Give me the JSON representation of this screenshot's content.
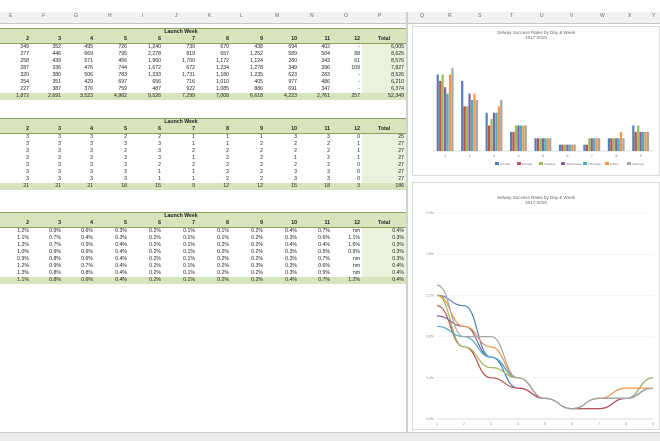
{
  "column_headers": [
    "E",
    "F",
    "G",
    "H",
    "I",
    "J",
    "K",
    "L",
    "M",
    "N",
    "O",
    "P",
    "Q",
    "R",
    "S",
    "T",
    "U",
    "V",
    "W",
    "X",
    "Y"
  ],
  "table1": {
    "title": "Launch Week",
    "headers": [
      "2",
      "3",
      "4",
      "5",
      "6",
      "7",
      "8",
      "9",
      "10",
      "11",
      "12",
      "Total"
    ],
    "rows": [
      [
        "249",
        "352",
        "495",
        "726",
        "1,240",
        "739",
        "670",
        "438",
        "694",
        "402",
        "-",
        "6,005"
      ],
      [
        "277",
        "446",
        "669",
        "795",
        "2,278",
        "819",
        "657",
        "1,252",
        "589",
        "504",
        "88",
        "8,625"
      ],
      [
        "258",
        "439",
        "571",
        "456",
        "1,960",
        "1,700",
        "1,172",
        "1,124",
        "280",
        "343",
        "61",
        "8,576"
      ],
      [
        "287",
        "336",
        "476",
        "744",
        "1,672",
        "672",
        "1,234",
        "1,278",
        "349",
        "396",
        "109",
        "7,827"
      ],
      [
        "320",
        "380",
        "506",
        "783",
        "1,233",
        "1,731",
        "1,180",
        "1,235",
        "623",
        "283",
        "-",
        "8,526"
      ],
      [
        "254",
        "351",
        "429",
        "697",
        "656",
        "716",
        "1,010",
        "405",
        "977",
        "486",
        "-",
        "6,210"
      ],
      [
        "227",
        "387",
        "376",
        "759",
        "487",
        "922",
        "1,085",
        "886",
        "691",
        "347",
        "-",
        "6,374"
      ]
    ],
    "total": [
      "1,872",
      "2,691",
      "3,523",
      "4,962",
      "9,526",
      "7,299",
      "7,008",
      "6,618",
      "4,223",
      "2,761",
      "257",
      "52,349"
    ]
  },
  "table2": {
    "title": "Launch Week",
    "headers": [
      "2",
      "3",
      "4",
      "5",
      "6",
      "7",
      "8",
      "9",
      "10",
      "11",
      "12",
      "Total"
    ],
    "rows": [
      [
        "3",
        "3",
        "3",
        "2",
        "2",
        "1",
        "1",
        "1",
        "3",
        "3",
        "0",
        "25"
      ],
      [
        "3",
        "3",
        "3",
        "3",
        "3",
        "1",
        "1",
        "2",
        "2",
        "2",
        "1",
        "27"
      ],
      [
        "3",
        "3",
        "3",
        "2",
        "3",
        "2",
        "2",
        "2",
        "2",
        "2",
        "1",
        "27"
      ],
      [
        "3",
        "3",
        "3",
        "3",
        "3",
        "1",
        "2",
        "2",
        "1",
        "2",
        "1",
        "27"
      ],
      [
        "3",
        "3",
        "3",
        "3",
        "2",
        "2",
        "2",
        "2",
        "2",
        "2",
        "0",
        "27"
      ],
      [
        "3",
        "3",
        "3",
        "3",
        "1",
        "1",
        "2",
        "2",
        "3",
        "3",
        "0",
        "27"
      ],
      [
        "3",
        "3",
        "3",
        "3",
        "1",
        "1",
        "2",
        "2",
        "3",
        "3",
        "0",
        "27"
      ]
    ],
    "total": [
      "21",
      "21",
      "21",
      "18",
      "15",
      "9",
      "12",
      "12",
      "15",
      "18",
      "3",
      "186"
    ]
  },
  "table3": {
    "title": "Launch Week",
    "headers": [
      "2",
      "3",
      "4",
      "5",
      "6",
      "7",
      "8",
      "9",
      "10",
      "11",
      "12",
      "Total"
    ],
    "rows": [
      [
        "1.2%",
        "0.9%",
        "0.6%",
        "0.3%",
        "0.2%",
        "0.1%",
        "0.1%",
        "0.2%",
        "0.4%",
        "0.7%",
        "nm",
        "0.4%"
      ],
      [
        "1.1%",
        "0.7%",
        "0.4%",
        "0.3%",
        "0.2%",
        "0.1%",
        "0.1%",
        "0.2%",
        "0.3%",
        "0.6%",
        "1.1%",
        "0.3%"
      ],
      [
        "1.2%",
        "0.7%",
        "0.5%",
        "0.4%",
        "0.2%",
        "0.1%",
        "0.2%",
        "0.2%",
        "0.4%",
        "0.4%",
        "1.6%",
        "0.3%"
      ],
      [
        "1.0%",
        "0.9%",
        "0.6%",
        "0.4%",
        "0.2%",
        "0.1%",
        "0.2%",
        "0.2%",
        "0.3%",
        "0.5%",
        "0.9%",
        "0.3%"
      ],
      [
        "0.9%",
        "0.8%",
        "0.6%",
        "0.4%",
        "0.2%",
        "0.1%",
        "0.2%",
        "0.2%",
        "0.3%",
        "0.7%",
        "nm",
        "0.3%"
      ],
      [
        "1.2%",
        "0.9%",
        "0.7%",
        "0.4%",
        "0.2%",
        "0.1%",
        "0.2%",
        "0.3%",
        "0.3%",
        "0.6%",
        "nm",
        "0.4%"
      ],
      [
        "1.3%",
        "0.8%",
        "0.8%",
        "0.4%",
        "0.2%",
        "0.1%",
        "0.2%",
        "0.2%",
        "0.3%",
        "0.9%",
        "nm",
        "0.4%"
      ]
    ],
    "total": [
      "1.1%",
      "0.8%",
      "0.6%",
      "0.4%",
      "0.2%",
      "0.1%",
      "0.2%",
      "0.2%",
      "0.4%",
      "0.7%",
      "1.2%",
      "0.4%"
    ]
  },
  "colors": {
    "header_fill": "#d8e4bc",
    "series": [
      "#4f81bd",
      "#c0504d",
      "#9bbb59",
      "#8064a2",
      "#4bacc6",
      "#f79646",
      "#a5a5a5"
    ]
  },
  "chart_data": [
    {
      "type": "bar",
      "title": "Selway Success Rates by Day & Week",
      "subtitle": "2017-2019",
      "categories": [
        "1",
        "2",
        "3",
        "4",
        "5",
        "6",
        "7",
        "8",
        "9"
      ],
      "series": [
        {
          "name": "Sunday",
          "values": [
            1.2,
            1.1,
            0.6,
            0.3,
            0.2,
            0.1,
            0.1,
            0.2,
            0.4
          ]
        },
        {
          "name": "Monday",
          "values": [
            1.1,
            0.7,
            0.4,
            0.3,
            0.2,
            0.1,
            0.1,
            0.2,
            0.3
          ]
        },
        {
          "name": "Tuesday",
          "values": [
            1.2,
            0.7,
            0.5,
            0.4,
            0.2,
            0.1,
            0.2,
            0.2,
            0.4
          ]
        },
        {
          "name": "Wednesday",
          "values": [
            1.0,
            0.9,
            0.6,
            0.4,
            0.2,
            0.1,
            0.2,
            0.2,
            0.3
          ]
        },
        {
          "name": "Thursday",
          "values": [
            0.9,
            0.8,
            0.6,
            0.4,
            0.2,
            0.1,
            0.2,
            0.2,
            0.3
          ]
        },
        {
          "name": "Friday",
          "values": [
            1.2,
            0.9,
            0.7,
            0.4,
            0.2,
            0.1,
            0.2,
            0.3,
            0.3
          ]
        },
        {
          "name": "Saturday",
          "values": [
            1.3,
            0.8,
            0.8,
            0.4,
            0.2,
            0.1,
            0.2,
            0.2,
            0.3
          ]
        }
      ],
      "ylim": [
        0,
        1.6
      ],
      "legend": "bottom"
    },
    {
      "type": "line",
      "title": "Selway Success Rates by Day & Week",
      "subtitle": "2017-2019",
      "x": [
        "1",
        "2",
        "3",
        "4",
        "5",
        "6",
        "7",
        "8",
        "9"
      ],
      "y_ticks": [
        "0.0%",
        "0.4%",
        "0.8%",
        "1.2%",
        "1.6%",
        "2.0%"
      ],
      "series": [
        {
          "values": [
            1.2,
            1.1,
            0.6,
            0.3,
            0.2,
            0.1,
            0.1,
            0.2,
            0.4
          ]
        },
        {
          "values": [
            1.1,
            0.7,
            0.4,
            0.3,
            0.2,
            0.1,
            0.1,
            0.2,
            0.3
          ]
        },
        {
          "values": [
            1.2,
            0.7,
            0.5,
            0.4,
            0.2,
            0.1,
            0.2,
            0.2,
            0.4
          ]
        },
        {
          "values": [
            1.0,
            0.9,
            0.6,
            0.4,
            0.2,
            0.1,
            0.2,
            0.2,
            0.3
          ]
        },
        {
          "values": [
            0.9,
            0.8,
            0.6,
            0.4,
            0.2,
            0.1,
            0.2,
            0.2,
            0.3
          ]
        },
        {
          "values": [
            1.2,
            0.9,
            0.7,
            0.4,
            0.2,
            0.1,
            0.2,
            0.3,
            0.3
          ]
        },
        {
          "values": [
            1.3,
            0.8,
            0.8,
            0.4,
            0.2,
            0.1,
            0.2,
            0.2,
            0.3
          ]
        }
      ],
      "ylim": [
        0,
        2.0
      ],
      "grid": true
    }
  ]
}
